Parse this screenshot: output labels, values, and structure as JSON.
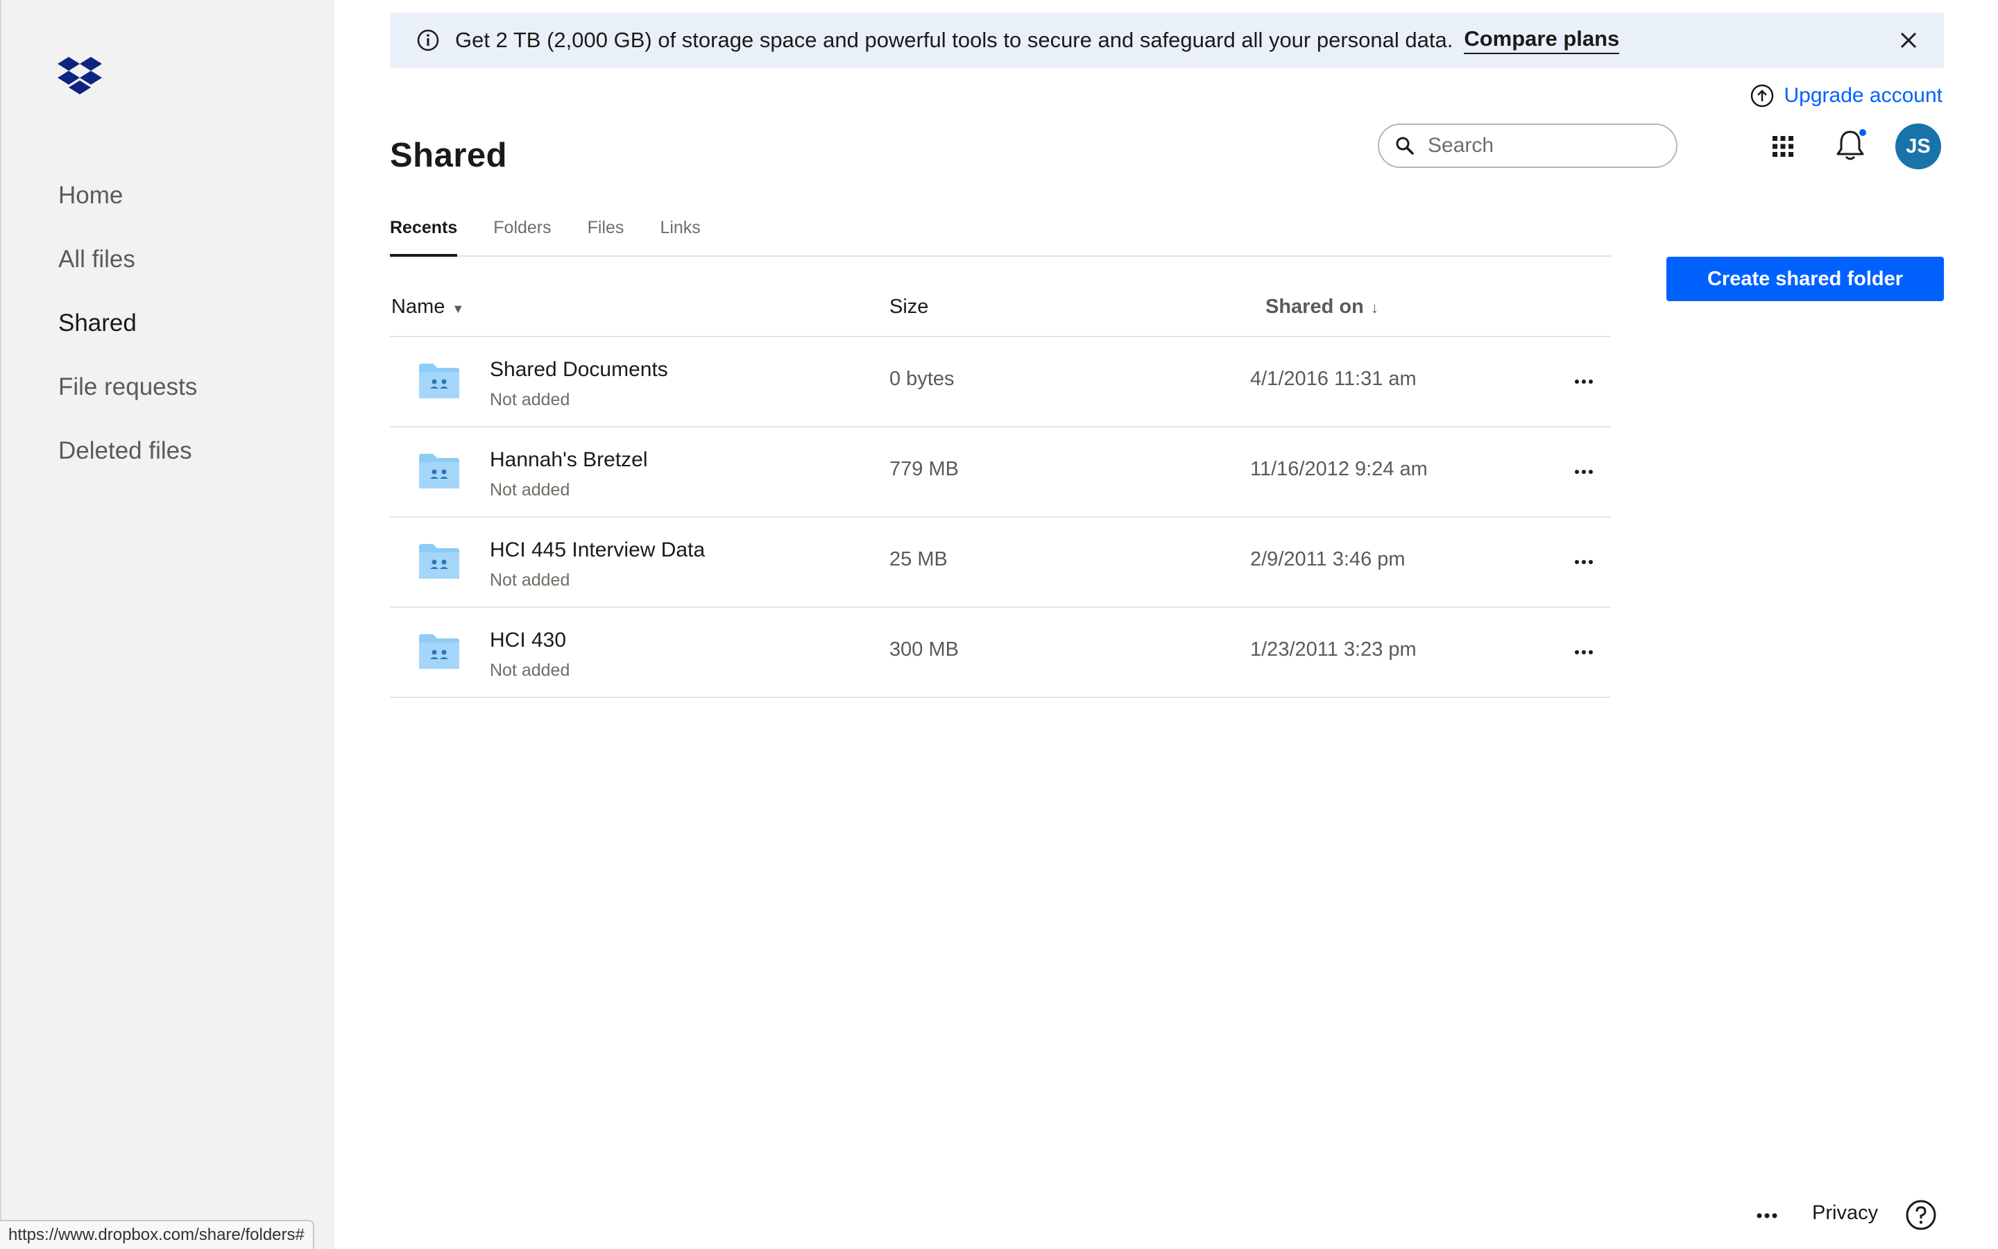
{
  "sidebar": {
    "items": [
      {
        "label": "Home"
      },
      {
        "label": "All files"
      },
      {
        "label": "Shared"
      },
      {
        "label": "File requests"
      },
      {
        "label": "Deleted files"
      }
    ],
    "active": "Shared"
  },
  "status_bar": {
    "url": "https://www.dropbox.com/share/folders#"
  },
  "banner": {
    "text": "Get 2 TB (2,000 GB) of storage space and powerful tools to secure and safeguard all your personal data.",
    "link_label": "Compare plans"
  },
  "header": {
    "upgrade_label": "Upgrade account",
    "title": "Shared",
    "search_placeholder": "Search",
    "avatar_initials": "JS"
  },
  "tabs": [
    {
      "label": "Recents"
    },
    {
      "label": "Folders"
    },
    {
      "label": "Files"
    },
    {
      "label": "Links"
    }
  ],
  "create_button_label": "Create shared folder",
  "table": {
    "columns": {
      "name": "Name",
      "size": "Size",
      "shared_on": "Shared on"
    },
    "rows": [
      {
        "name": "Shared Documents",
        "status": "Not added",
        "size": "0 bytes",
        "shared_on": "4/1/2016 11:31 am"
      },
      {
        "name": "Hannah's Bretzel",
        "status": "Not added",
        "size": "779 MB",
        "shared_on": "11/16/2012 9:24 am"
      },
      {
        "name": "HCI 445 Interview Data",
        "status": "Not added",
        "size": "25 MB",
        "shared_on": "2/9/2011 3:46 pm"
      },
      {
        "name": "HCI 430",
        "status": "Not added",
        "size": "300 MB",
        "shared_on": "1/23/2011 3:23 pm"
      }
    ]
  },
  "footer": {
    "privacy_label": "Privacy"
  },
  "colors": {
    "accent": "#0061fe",
    "banner_bg": "#e9f0fa",
    "sidebar_bg": "#f2f2f2",
    "avatar_bg": "#1873a8",
    "folder": "#8ecbf7",
    "logo": "#0d2481"
  },
  "icons": [
    "dropbox-logo",
    "info-icon",
    "close-icon",
    "upgrade-arrow-icon",
    "search-icon",
    "app-grid-icon",
    "bell-icon",
    "shared-folder-icon",
    "more-icon",
    "help-icon"
  ]
}
